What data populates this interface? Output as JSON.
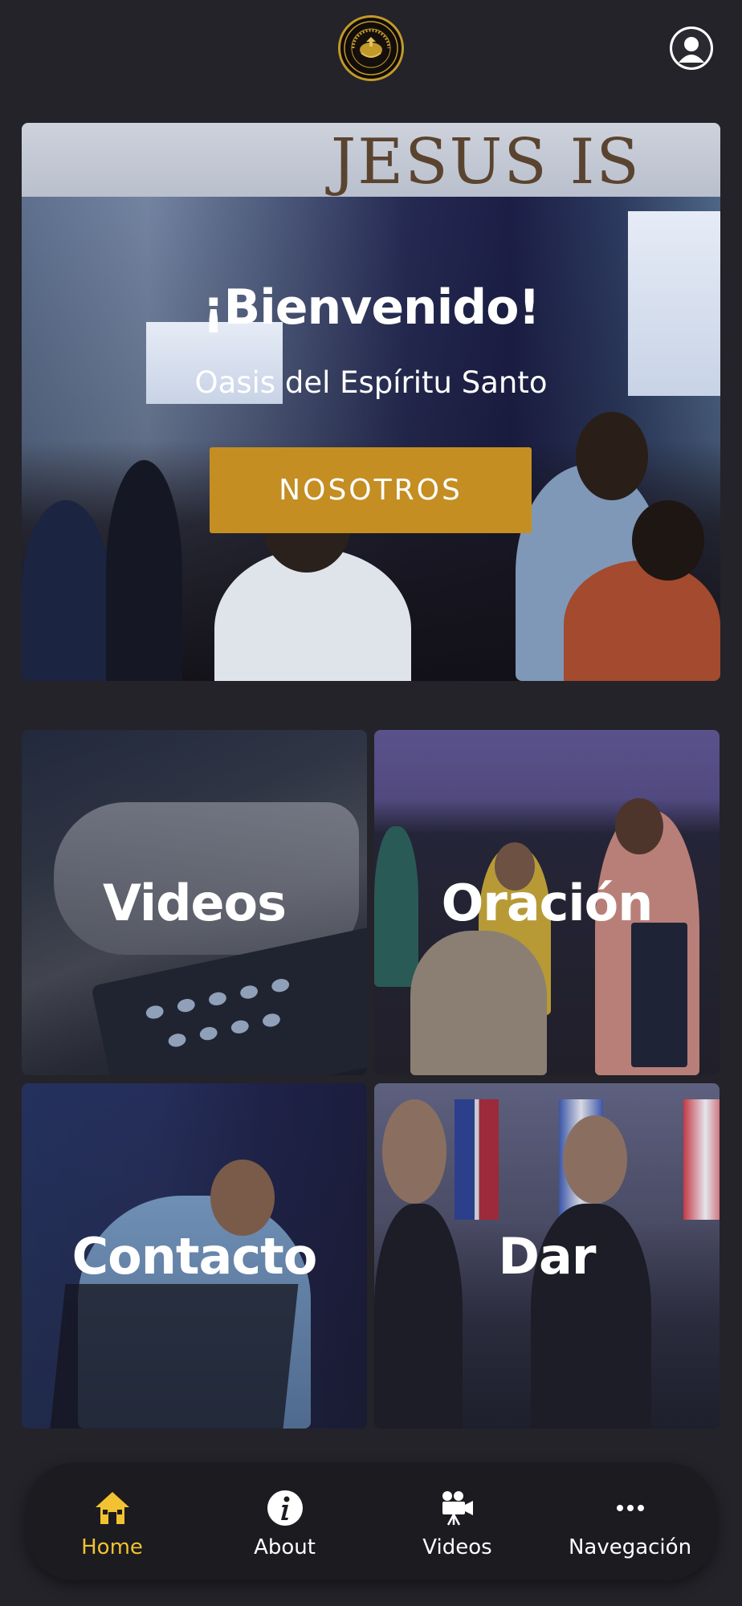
{
  "header": {
    "logo_text": "ASAMBLEAS DE DIOS · OASIS DEL ESPIRITU SANTO",
    "profile_icon": "user-circle-icon"
  },
  "hero": {
    "title": "¡Bienvenido!",
    "subtitle": "Oasis del Espíritu Santo",
    "button_label": "NOSOTROS",
    "button_color": "#c48e23",
    "background_text": "JESUS IS"
  },
  "tiles": [
    {
      "label": "Videos"
    },
    {
      "label": "Oración"
    },
    {
      "label": "Contacto"
    },
    {
      "label": "Dar"
    }
  ],
  "bottom_nav": {
    "active_color": "#f2c230",
    "items": [
      {
        "label": "Home",
        "icon": "home-icon",
        "active": true
      },
      {
        "label": "About",
        "icon": "info-icon",
        "active": false
      },
      {
        "label": "Videos",
        "icon": "video-camera-icon",
        "active": false
      },
      {
        "label": "Navegación",
        "icon": "more-dots-icon",
        "active": false
      }
    ]
  }
}
